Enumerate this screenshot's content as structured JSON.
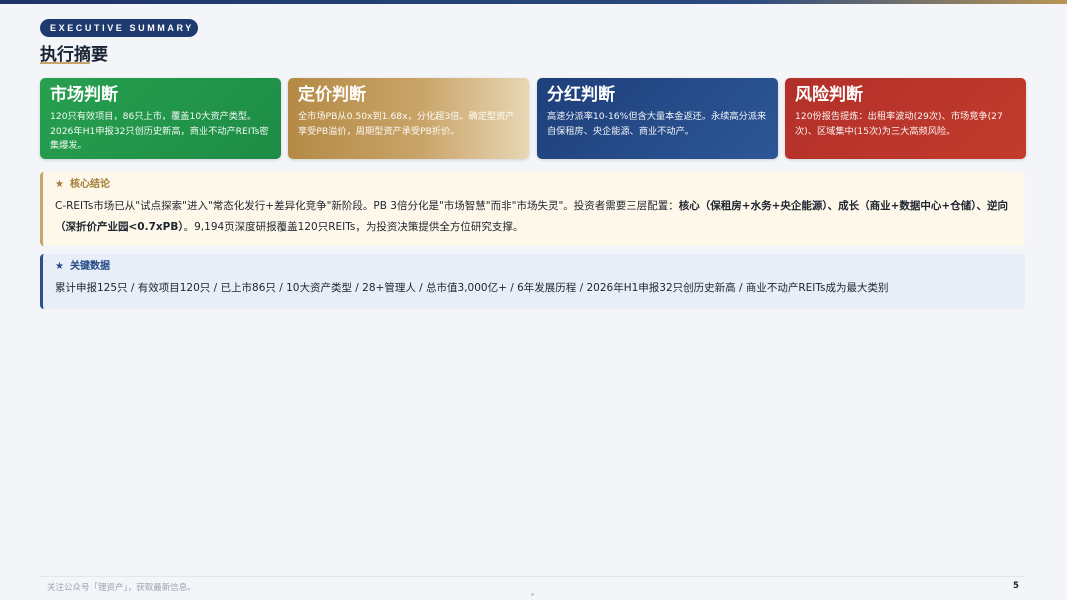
{
  "header": {
    "badge": "EXECUTIVE SUMMARY",
    "title": "执行摘要"
  },
  "cards": [
    {
      "title": "市场判断",
      "body": "120只有效项目，86只上市，覆盖10大资产类型。2026年H1申报32只创历史新高，商业不动产REITs密集爆发。",
      "color": "#27a04f"
    },
    {
      "title": "定价判断",
      "body": "全市场PB从0.50x到1.68x，分化超3倍。确定型资产享受PB溢价，周期型资产承受PB折价。",
      "color": "#b48a45"
    },
    {
      "title": "分红判断",
      "body": "高速分派率10-16%但含大量本金返还。永续高分派来自保租房、央企能源、商业不动产。",
      "color": "#1e3f7a"
    },
    {
      "title": "风险判断",
      "body": "120份报告提炼：出租率波动(29次)、市场竞争(27次)、区域集中(15次)为三大高频风险。",
      "color": "#b3302a"
    }
  ],
  "conclusion": {
    "star": "★",
    "heading": "核心结论",
    "text_1": "C-REITs市场已从\"试点探索\"进入\"常态化发行+差异化竞争\"新阶段。PB 3倍分化是\"市场智慧\"而非\"市场失灵\"。投资者需要三层配置：",
    "bold_1": "核心（保租房+水务+央企能源）、成长（商业+数据中心+仓储）、逆向（深折价产业园<0.7xPB）",
    "text_2": "。9,194页深度研报覆盖120只REITs，为投资决策提供全方位研究支撑。"
  },
  "key_data": {
    "star": "★",
    "heading": "关键数据",
    "text": "累计申报125只 / 有效项目120只 / 已上市86只 / 10大资产类型 / 28+管理人 / 总市值3,000亿+ / 6年发展历程 / 2026年H1申报32只创历史新高 / 商业不动产REITs成为最大类别"
  },
  "footer": {
    "note": "关注公众号「锂资产」，获取最新信息。",
    "page": "5"
  }
}
